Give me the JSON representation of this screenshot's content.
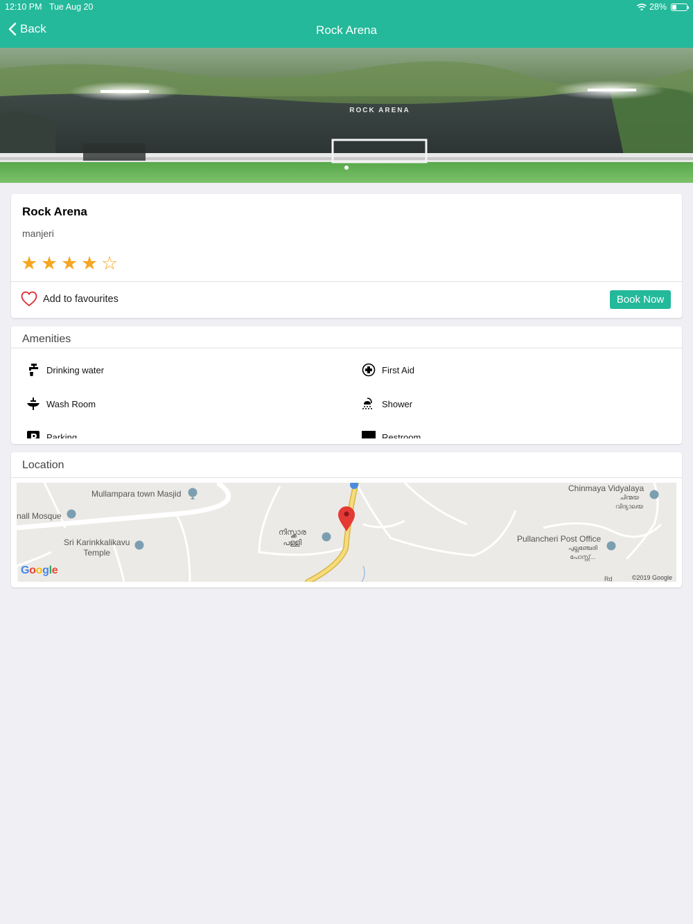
{
  "status_bar": {
    "time": "12:10 PM",
    "date": "Tue Aug 20",
    "battery_percent": "28%",
    "battery_level": 0.28
  },
  "nav": {
    "back_label": "Back",
    "title": "Rock Arena"
  },
  "hero": {
    "slides": 1,
    "active_slide": 1,
    "banner_text": "ROCK ARENA"
  },
  "venue": {
    "name": "Rock Arena",
    "city": "manjeri",
    "rating": 4,
    "rating_max": 5,
    "stars": [
      "★",
      "★",
      "★",
      "★",
      "☆"
    ],
    "favourite_label": "Add to favourites",
    "book_label": "Book Now"
  },
  "amenities": {
    "title": "Amenities",
    "items": [
      {
        "label": "Drinking water",
        "icon": "tap-icon"
      },
      {
        "label": "First Aid",
        "icon": "first-aid-icon"
      },
      {
        "label": "Wash Room",
        "icon": "sink-icon"
      },
      {
        "label": "Shower",
        "icon": "shower-icon"
      },
      {
        "label": "Parking",
        "icon": "parking-icon"
      },
      {
        "label": "Restroom",
        "icon": "restroom-icon"
      }
    ]
  },
  "location": {
    "title": "Location",
    "map_labels": {
      "masjid": "Mullampara town Masjid",
      "mosque": "nall Mosque",
      "temple_line1": "Sri Karinkkalikavu",
      "temple_line2": "Temple",
      "mal_place_line1": "നിസ്ക്കാര",
      "mal_place_line2": "പള്ളി",
      "school": "Chinmaya Vidyalaya",
      "school_mal_line1": "ചിന്മയ",
      "school_mal_line2": "വിദ്യാലയ",
      "post_office": "Pullancheri Post Office",
      "post_mal_line1": "പുല്ലഞ്ചേരി",
      "post_mal_line2": "പോസ്റ്റ്...",
      "road": "Rd"
    },
    "google_logo": "Google",
    "copyright": "©2019 Google"
  },
  "colors": {
    "accent": "#23b99a",
    "star": "#f5a623",
    "heart": "#e0262f",
    "map_pin": "#e53935"
  }
}
